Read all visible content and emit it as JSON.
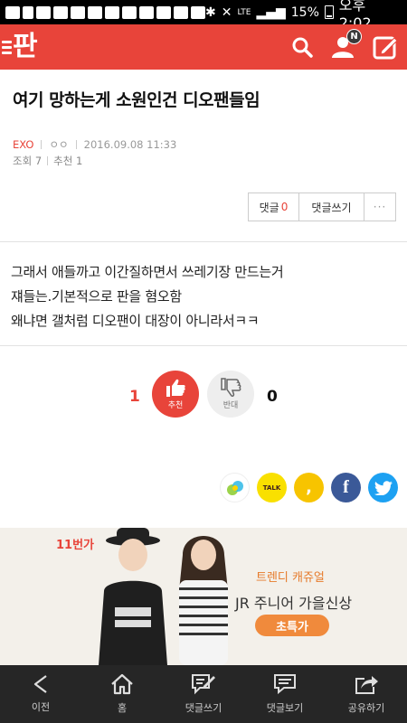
{
  "status_bar": {
    "network": "LTE",
    "battery": "15%",
    "time": "오후 2:02"
  },
  "header": {
    "logo": "판",
    "notification_badge": "N",
    "brand_color": "#e8443a"
  },
  "article": {
    "title": "여기 망하는게 소원인건 디오팬들임",
    "category": "EXO",
    "author": "ㅇㅇ",
    "datetime": "2016.09.08 11:33",
    "views": "조회 7",
    "recommend": "추천 1",
    "body_lines": [
      "그래서 애들까고 이간질하면서 쓰레기장 만드는거",
      "쟤들는.기본적으로 판을 혐오함",
      "왜냐면 갤처럼 디오팬이 대장이 아니라서ㅋㅋ"
    ]
  },
  "comment_bar": {
    "comments_label": "댓글",
    "comments_count": "0",
    "write_label": "댓글쓰기",
    "more_label": "···"
  },
  "vote": {
    "up_count": "1",
    "up_label": "추천",
    "down_label": "반대",
    "down_count": "0"
  },
  "share": {
    "talk_label": "TALK",
    "story_label": ",",
    "facebook_label": "f"
  },
  "ad": {
    "logo": "11번가",
    "tagline": "트렌디 캐쥬얼",
    "headline": "JR 주니어 가을신상",
    "button": "초특가"
  },
  "bottom_nav": [
    {
      "label": "이전",
      "icon": "back-icon"
    },
    {
      "label": "홈",
      "icon": "home-icon"
    },
    {
      "label": "댓글쓰기",
      "icon": "write-comment-icon"
    },
    {
      "label": "댓글보기",
      "icon": "view-comments-icon"
    },
    {
      "label": "공유하기",
      "icon": "share-icon"
    }
  ]
}
